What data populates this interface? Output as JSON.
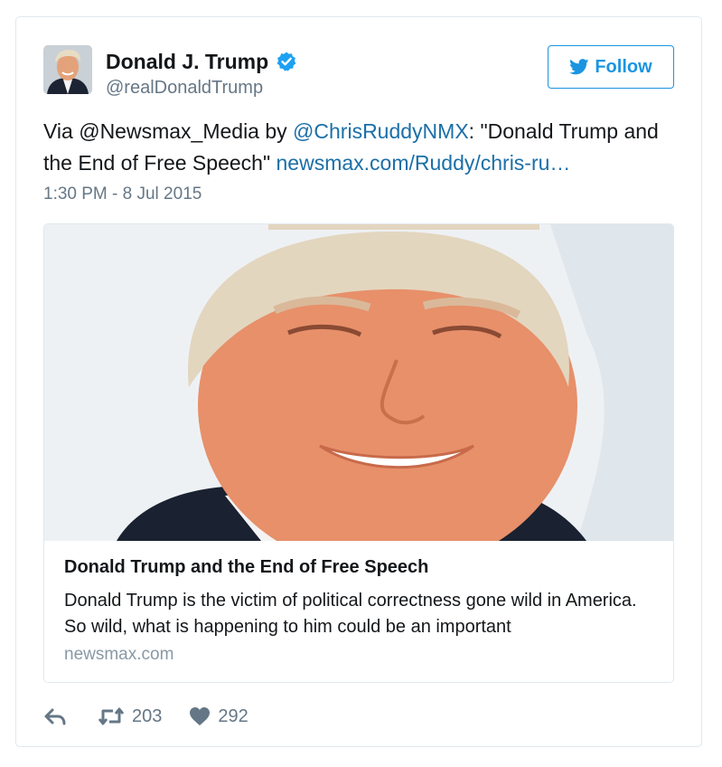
{
  "tweet": {
    "author": {
      "name": "Donald J. Trump",
      "handle": "@realDonaldTrump",
      "verified": true,
      "verified_icon": "verified-badge-icon",
      "avatar_icon": "avatar"
    },
    "follow_button": {
      "label": "Follow",
      "icon": "twitter-bird-icon"
    },
    "text": {
      "prefix": "Via ",
      "mention_newsmax": "@Newsmax_Media",
      "middle": " by ",
      "mention_ruddy": "@ChrisRuddyNMX",
      "quote": ": \"Donald Trump and the End of Free Speech\" ",
      "url": "newsmax.com/Ruddy/chris-ru…"
    },
    "timestamp": "1:30 PM - 8 Jul 2015",
    "card": {
      "title": "Donald Trump and the End of Free Speech",
      "description": "Donald Trump is the victim of political correctness gone wild in America. So wild, what is happening to him could be an important",
      "domain": "newsmax.com"
    },
    "actions": {
      "reply_icon": "reply-icon",
      "retweet_icon": "retweet-icon",
      "retweet_count": "203",
      "like_icon": "heart-icon",
      "like_count": "292"
    },
    "colors": {
      "accent": "#1b95e0",
      "link": "#1b6fa8",
      "secondary_text": "#657786",
      "border": "#e1e8ed"
    }
  }
}
